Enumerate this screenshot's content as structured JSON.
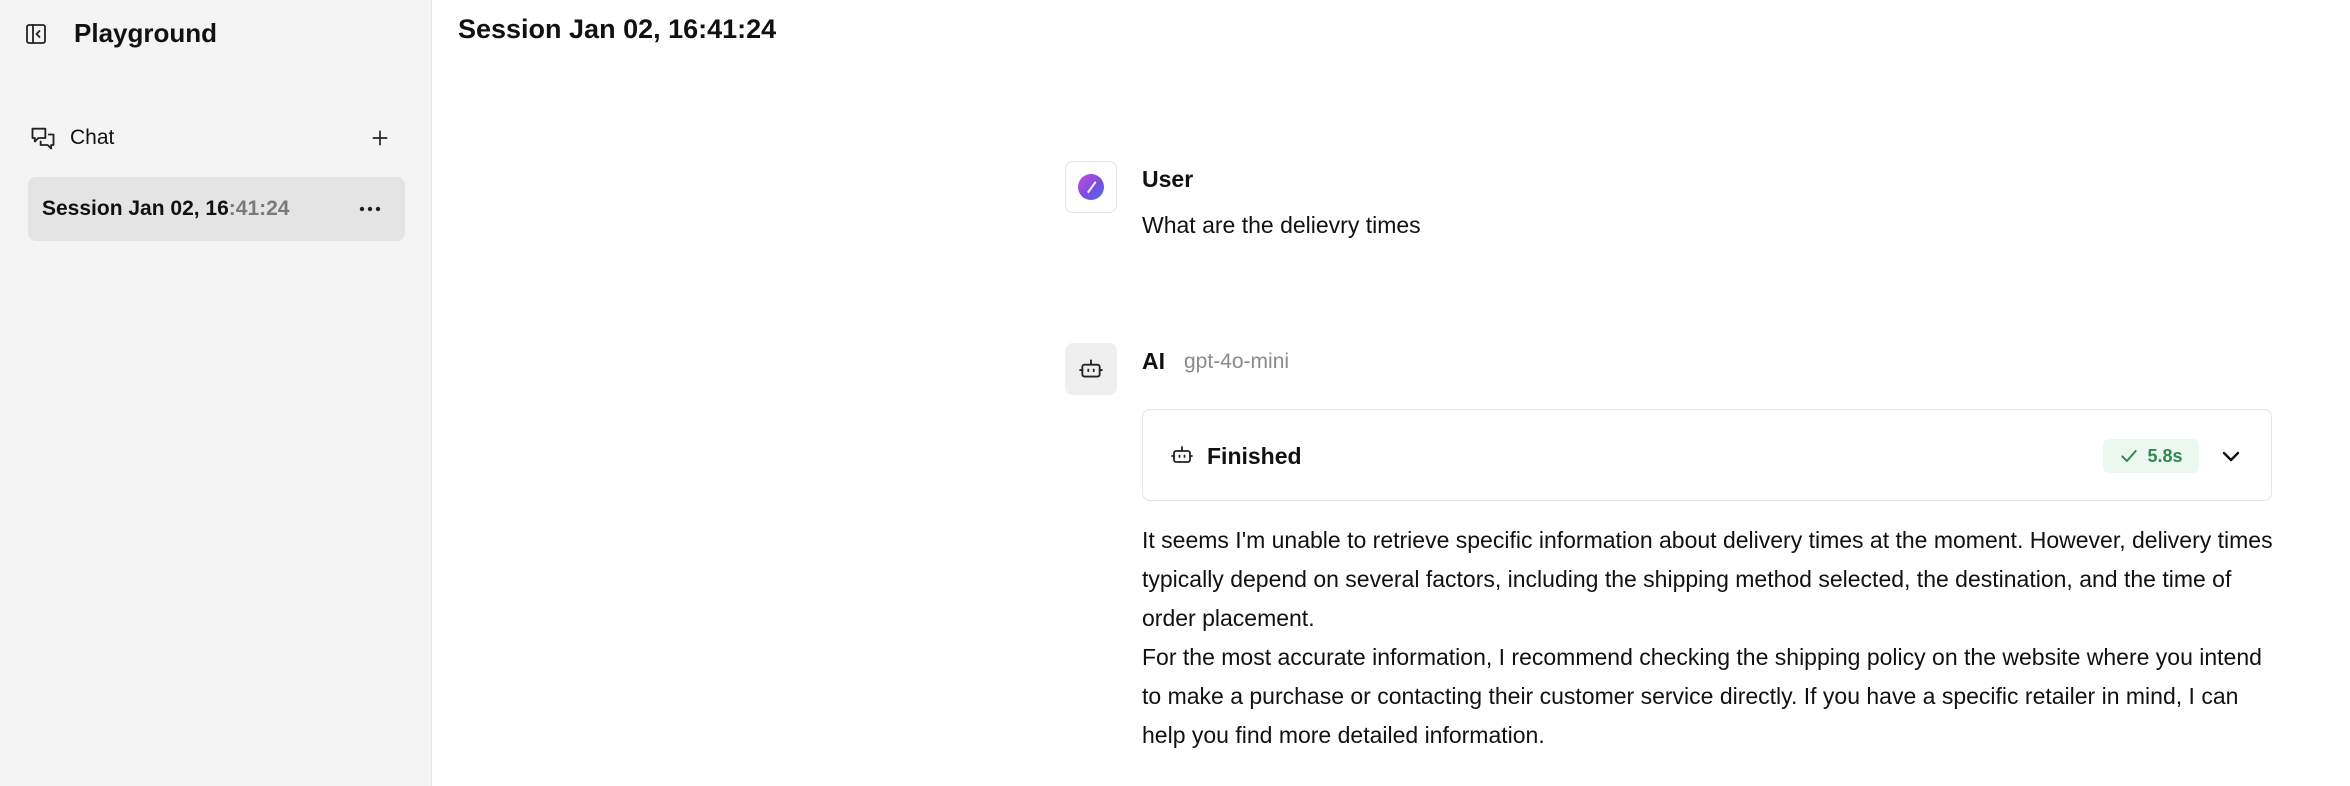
{
  "sidebar": {
    "toggle_icon": "sidebar-collapse-icon",
    "title": "Playground",
    "section": {
      "icon": "chat-bubbles-icon",
      "label": "Chat",
      "add_icon": "plus-icon"
    },
    "sessions": [
      {
        "label_main": "Session Jan 02, 16",
        "label_dim": ":41:24",
        "more_icon": "more-horizontal-icon"
      }
    ]
  },
  "main": {
    "title": "Session Jan 02, 16:41:24",
    "messages": [
      {
        "role": "User",
        "avatar_icon": "user-avatar-icon",
        "text": "What are the delievry times"
      },
      {
        "role": "AI",
        "avatar_icon": "robot-icon",
        "model": "gpt-4o-mini",
        "status": {
          "icon": "robot-icon",
          "label": "Finished",
          "duration": "5.8s",
          "duration_icon": "check-icon",
          "expand_icon": "chevron-down-icon"
        },
        "paragraphs": [
          "It seems I'm unable to retrieve specific information about delivery times at the moment. However, delivery times typically depend on several factors, including the shipping method selected, the destination, and the time of order placement.",
          "For the most accurate information, I recommend checking the shipping policy on the website where you intend to make a purchase or contacting their customer service directly. If you have a specific retailer in mind, I can help you find more detailed information."
        ]
      }
    ]
  },
  "colors": {
    "sidebar_bg": "#f4f4f4",
    "session_active_bg": "#e4e4e4",
    "success_green": "#2f8a4f",
    "success_bg": "#ecf7ef",
    "muted_text": "#8a8a8a"
  }
}
